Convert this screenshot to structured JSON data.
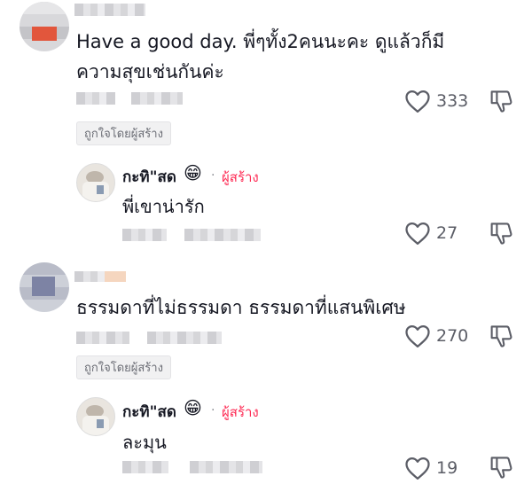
{
  "comments": [
    {
      "text_line1": "Have a good day. พี่ๆทั้ง2คนนะคะ ดูแล้วก็มี",
      "text_line2": "ความสุขเช่นกันค่ะ",
      "likes": "333",
      "creator_liked": "ถูกใจโดยผู้สร้าง",
      "reply": {
        "name": "กะทิ\"สด",
        "emoji": "😁",
        "dot": "·",
        "author_tag": "ผู้สร้าง",
        "text": "พี่เขาน่ารัก",
        "likes": "27"
      }
    },
    {
      "text_line1": "ธรรมดาที่ไม่ธรรมดา ธรรมดาที่แสนพิเศษ",
      "likes": "270",
      "creator_liked": "ถูกใจโดยผู้สร้าง",
      "reply": {
        "name": "กะทิ\"สด",
        "emoji": "😁",
        "dot": "·",
        "author_tag": "ผู้สร้าง",
        "text": "ละมุน",
        "likes": "19"
      }
    }
  ],
  "icons": {
    "like": "heart-outline-icon",
    "dislike": "thumbs-down-outline-icon"
  },
  "colors": {
    "author_tag": "#fe2c55",
    "text": "#161823",
    "muted": "#5b5d66"
  }
}
